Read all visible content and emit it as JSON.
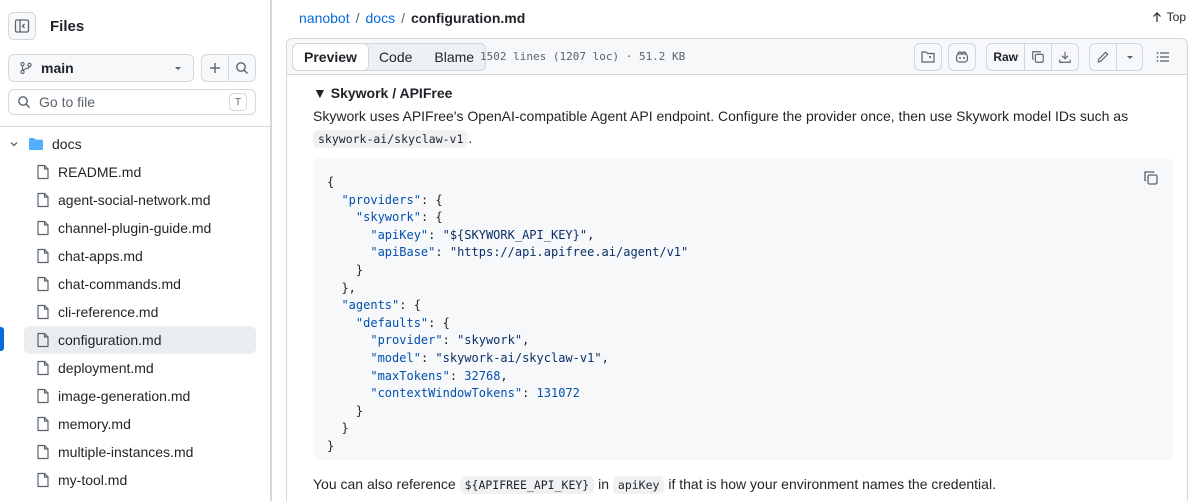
{
  "sidebar": {
    "title": "Files",
    "branch": "main",
    "goto_placeholder": "Go to file",
    "goto_shortcut": "T",
    "folder": "docs",
    "files": [
      "README.md",
      "agent-social-network.md",
      "channel-plugin-guide.md",
      "chat-apps.md",
      "chat-commands.md",
      "cli-reference.md",
      "configuration.md",
      "deployment.md",
      "image-generation.md",
      "memory.md",
      "multiple-instances.md",
      "my-tool.md"
    ],
    "active_file": "configuration.md"
  },
  "breadcrumb": {
    "repo": "nanobot",
    "sep": "/",
    "folder": "docs",
    "file": "configuration.md"
  },
  "top_link": "Top",
  "toolbar": {
    "tabs": [
      "Preview",
      "Code",
      "Blame"
    ],
    "active_tab": "Preview",
    "meta": "1502 lines (1207 loc) · 51.2 KB",
    "raw_label": "Raw"
  },
  "content": {
    "summary": "▼ Skywork / APIFree",
    "para1_text": "Skywork uses APIFree's OpenAI-compatible Agent API endpoint. Configure the provider once, then use Skywork model IDs such as",
    "para1_code": "skywork-ai/skyclaw-v1",
    "para1_end": ".",
    "code_lines": [
      "{",
      "  \"providers\": {",
      "    \"skywork\": {",
      "      \"apiKey\": \"${SKYWORK_API_KEY}\",",
      "      \"apiBase\": \"https://api.apifree.ai/agent/v1\"",
      "    }",
      "  },",
      "  \"agents\": {",
      "    \"defaults\": {",
      "      \"provider\": \"skywork\",",
      "      \"model\": \"skywork-ai/skyclaw-v1\",",
      "      \"maxTokens\": 32768,",
      "      \"contextWindowTokens\": 131072",
      "    }",
      "  }",
      "}"
    ],
    "para2_a": "You can also reference",
    "para2_code1": "${APIFREE_API_KEY}",
    "para2_b": "in",
    "para2_code2": "apiKey",
    "para2_c": "if that is how your environment names the credential."
  },
  "colors": {
    "accent": "#0969da",
    "border": "#d1d9e0",
    "json_key": "#0550ae",
    "json_string": "#0a3069"
  }
}
